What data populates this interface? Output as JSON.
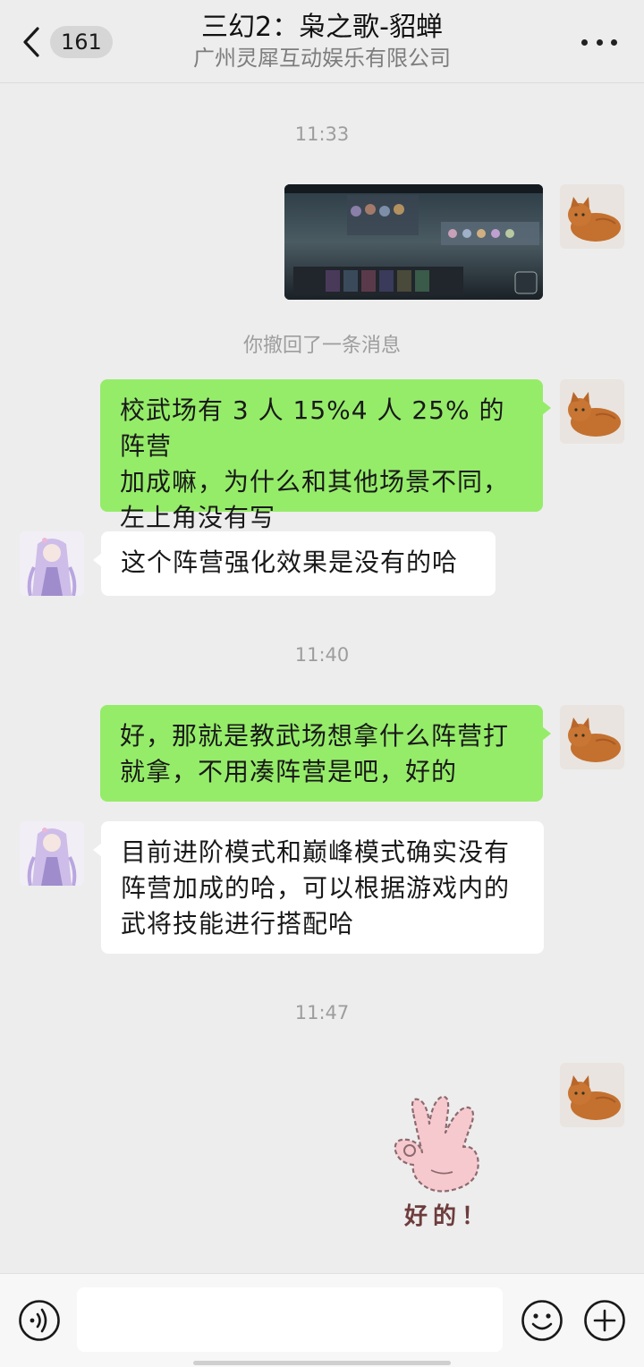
{
  "header": {
    "back_icon": "chevron-left-icon",
    "unread_count": "161",
    "title": "三幻2：枭之歌-貂蝉",
    "subtitle": "广州灵犀互动娱乐有限公司",
    "more_icon": "more-dots-icon"
  },
  "messages": [
    {
      "type": "timestamp",
      "text": "11:33"
    },
    {
      "type": "image",
      "from": "me",
      "icon": "game-screenshot-thumbnail"
    },
    {
      "type": "system",
      "text": "你撤回了一条消息"
    },
    {
      "type": "text",
      "from": "me",
      "lines": [
        "校武场有 3 人 15%4 人 25% 的阵营",
        "加成嘛，为什么和其他场景不同，",
        "左上角没有写"
      ]
    },
    {
      "type": "text",
      "from": "other",
      "lines": [
        "这个阵营强化效果是没有的哈"
      ]
    },
    {
      "type": "timestamp",
      "text": "11:40"
    },
    {
      "type": "text",
      "from": "me",
      "lines": [
        "好，那就是教武场想拿什么阵营打",
        "就拿，不用凑阵营是吧，好的"
      ]
    },
    {
      "type": "text",
      "from": "other",
      "lines": [
        "目前进阶模式和巅峰模式确实没有",
        "阵营加成的哈，可以根据游戏内的",
        "武将技能进行搭配哈"
      ]
    },
    {
      "type": "timestamp",
      "text": "11:47"
    },
    {
      "type": "sticker",
      "from": "me",
      "icon": "ok-hand-sticker",
      "text": "好的！"
    }
  ],
  "input_bar": {
    "voice_icon": "voice-icon",
    "input_value": "",
    "emoji_icon": "emoji-icon",
    "plus_icon": "plus-icon"
  },
  "colors": {
    "background": "#ededed",
    "my_bubble": "#95ec69",
    "their_bubble": "#ffffff",
    "timestamp_text": "#9d9d9d"
  }
}
